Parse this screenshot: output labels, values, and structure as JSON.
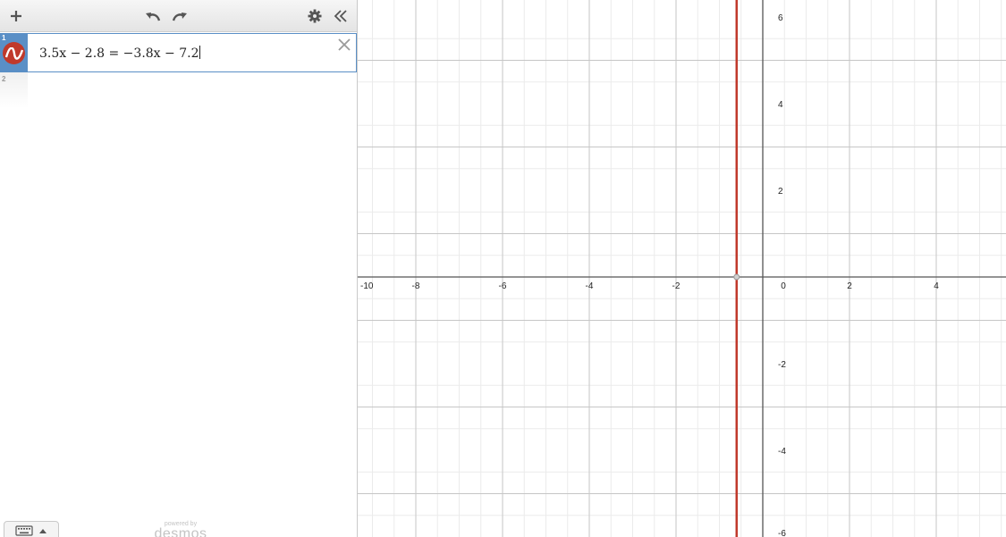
{
  "toolbar": {
    "add_icon": "plus-icon",
    "undo_icon": "undo-icon",
    "redo_icon": "redo-icon",
    "settings_icon": "gear-icon",
    "collapse_icon": "double-chevron-left-icon"
  },
  "expressions": [
    {
      "index": "1",
      "latex_text": "3.5x − 2.8 = −3.8x − 7.2",
      "color": "#c0392b",
      "active": true
    },
    {
      "index": "2",
      "latex_text": "",
      "active": false
    }
  ],
  "footer": {
    "keyboard_icon": "keyboard-icon",
    "powered_by": "powered by",
    "brand": "desmos"
  },
  "graph": {
    "x_range": [
      -10,
      5
    ],
    "y_range": [
      -6,
      6.3
    ],
    "major_step": 2,
    "minor_step": 0.5,
    "x_tick_labels": [
      "-10",
      "-8",
      "-6",
      "-4",
      "-2",
      "0",
      "2",
      "4"
    ],
    "y_tick_labels": [
      "6",
      "4",
      "2",
      "-2",
      "-4",
      "-6"
    ],
    "line_color": "#c0392b",
    "vertical_line_x": -0.6027,
    "grid": true
  }
}
